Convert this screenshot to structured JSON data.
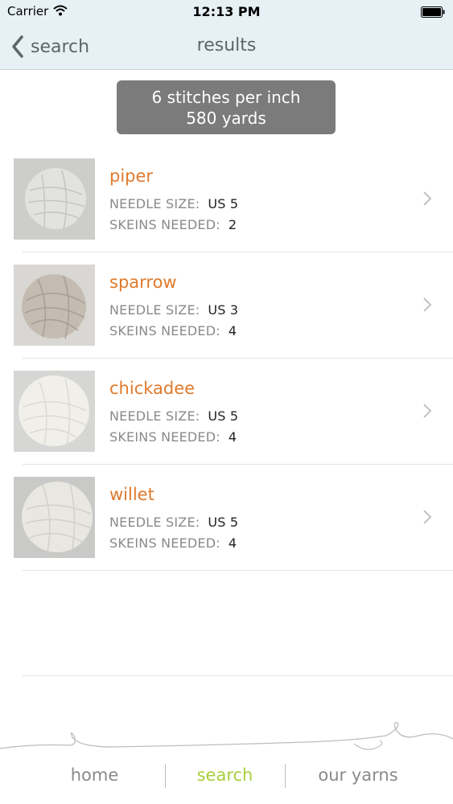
{
  "status_bar": {
    "carrier": "Carrier",
    "time": "12:13 PM"
  },
  "nav": {
    "back_label": "search",
    "title": "results"
  },
  "summary": {
    "line1": "6 stitches per inch",
    "line2": "580 yards"
  },
  "labels": {
    "needle_size": "NEEDLE SIZE:",
    "skeins_needed": "SKEINS NEEDED:"
  },
  "results": [
    {
      "name": "piper",
      "needle_size": "US 5",
      "skeins": "2",
      "thumb_color": "#d8d8d6"
    },
    {
      "name": "sparrow",
      "needle_size": "US 3",
      "skeins": "4",
      "thumb_color": "#c9c2b8"
    },
    {
      "name": "chickadee",
      "needle_size": "US 5",
      "skeins": "4",
      "thumb_color": "#ecebe6"
    },
    {
      "name": "willet",
      "needle_size": "US 5",
      "skeins": "4",
      "thumb_color": "#e4e2dc"
    }
  ],
  "tabs": {
    "home": "home",
    "search": "search",
    "our_yarns": "our yarns"
  },
  "colors": {
    "accent_orange": "#e07a2c",
    "active_tab_green": "#a8cf3a",
    "nav_bg": "#e6f0f5",
    "summary_bg": "#7b7b7b"
  }
}
